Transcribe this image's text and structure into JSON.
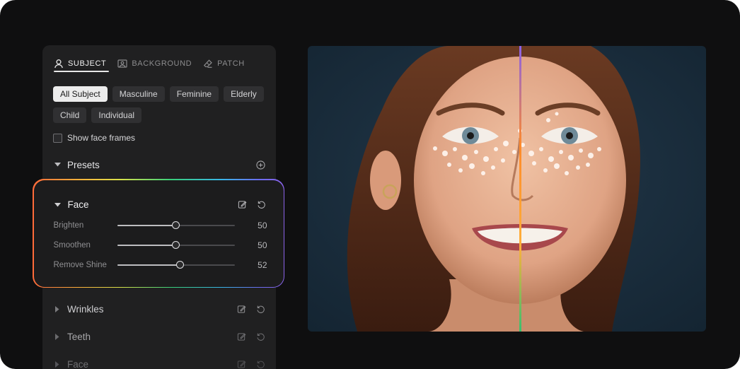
{
  "tabs": [
    {
      "label": "SUBJECT",
      "icon": "person-icon",
      "active": true
    },
    {
      "label": "BACKGROUND",
      "icon": "image-icon",
      "active": false
    },
    {
      "label": "PATCH",
      "icon": "eraser-icon",
      "active": false
    }
  ],
  "chips": [
    {
      "label": "All Subject",
      "active": true
    },
    {
      "label": "Masculine",
      "active": false
    },
    {
      "label": "Feminine",
      "active": false
    },
    {
      "label": "Elderly",
      "active": false
    },
    {
      "label": "Child",
      "active": false
    },
    {
      "label": "Individual",
      "active": false
    }
  ],
  "show_face_frames": {
    "label": "Show face frames",
    "checked": false
  },
  "presets": {
    "label": "Presets",
    "icon": "plus-circle-icon"
  },
  "face": {
    "label": "Face",
    "sliders": [
      {
        "label": "Brighten",
        "value": "50",
        "fraction": 0.5
      },
      {
        "label": "Smoothen",
        "value": "50",
        "fraction": 0.5
      },
      {
        "label": "Remove Shine",
        "value": "52",
        "fraction": 0.54
      }
    ]
  },
  "sections": [
    {
      "label": "Wrinkles"
    },
    {
      "label": "Teeth"
    },
    {
      "label": "Face"
    }
  ],
  "colors": {
    "frame_bg": "#0f0f10",
    "panel_bg": "#202021",
    "photo_bg": "#1b2a36",
    "divider_gradient": [
      "#8a62e8",
      "#ff8a2a",
      "#ffb03a",
      "#38c070"
    ]
  }
}
